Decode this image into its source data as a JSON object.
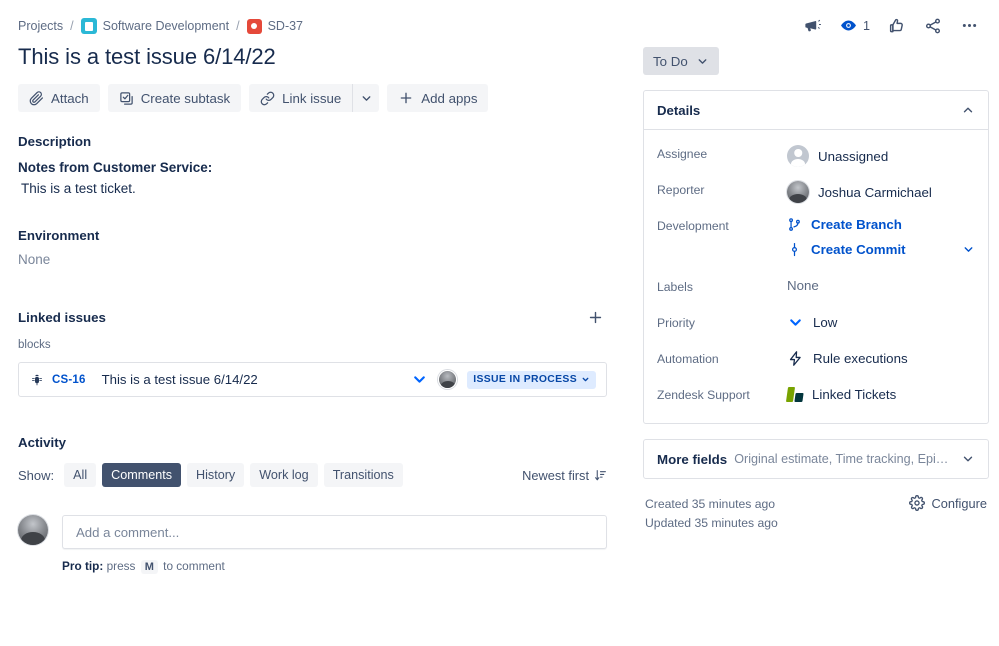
{
  "breadcrumb": {
    "projects_label": "Projects",
    "separator": "/",
    "project_name": "Software Development",
    "issue_key": "SD-37"
  },
  "issue": {
    "title": "This is a test issue 6/14/22"
  },
  "toolbar": {
    "attach_label": "Attach",
    "create_subtask_label": "Create subtask",
    "link_issue_label": "Link issue",
    "add_apps_label": "Add apps"
  },
  "description": {
    "heading": "Description",
    "bold_line": "Notes from Customer Service:",
    "body": "This is a test ticket."
  },
  "environment": {
    "heading": "Environment",
    "value": "None"
  },
  "linked_issues": {
    "heading": "Linked issues",
    "relationship": "blocks",
    "rows": [
      {
        "key": "CS-16",
        "summary": "This is a test issue 6/14/22",
        "status": "ISSUE IN PROCESS"
      }
    ]
  },
  "activity": {
    "heading": "Activity",
    "show_label": "Show:",
    "filters": [
      {
        "label": "All",
        "active": false
      },
      {
        "label": "Comments",
        "active": true
      },
      {
        "label": "History",
        "active": false
      },
      {
        "label": "Work log",
        "active": false
      },
      {
        "label": "Transitions",
        "active": false
      }
    ],
    "sort_label": "Newest first",
    "comment_placeholder": "Add a comment...",
    "pro_tip_prefix": "Pro tip:",
    "pro_tip_press": "press",
    "pro_tip_key": "M",
    "pro_tip_suffix": "to comment"
  },
  "header_actions": {
    "watch_count": "1"
  },
  "status": {
    "current": "To Do"
  },
  "details": {
    "panel_title": "Details",
    "fields": {
      "assignee_label": "Assignee",
      "assignee_value": "Unassigned",
      "reporter_label": "Reporter",
      "reporter_value": "Joshua Carmichael",
      "development_label": "Development",
      "development_branch": "Create Branch",
      "development_commit": "Create Commit",
      "labels_label": "Labels",
      "labels_value": "None",
      "priority_label": "Priority",
      "priority_value": "Low",
      "automation_label": "Automation",
      "automation_value": "Rule executions",
      "zendesk_label": "Zendesk Support",
      "zendesk_value": "Linked Tickets"
    }
  },
  "more_fields": {
    "title": "More fields",
    "summary": "Original estimate, Time tracking, Epic Link, Comp..."
  },
  "footer": {
    "created": "Created 35 minutes ago",
    "updated": "Updated 35 minutes ago",
    "configure_label": "Configure"
  },
  "colors": {
    "link_blue": "#0052cc",
    "text_primary": "#172b4d",
    "text_subtle": "#5e6c84",
    "bug_red": "#e5493a",
    "project_teal": "#2bb8d6",
    "lozenge_bg": "#deebff",
    "lozenge_text": "#0747a6",
    "chip_active_bg": "#42526e"
  }
}
